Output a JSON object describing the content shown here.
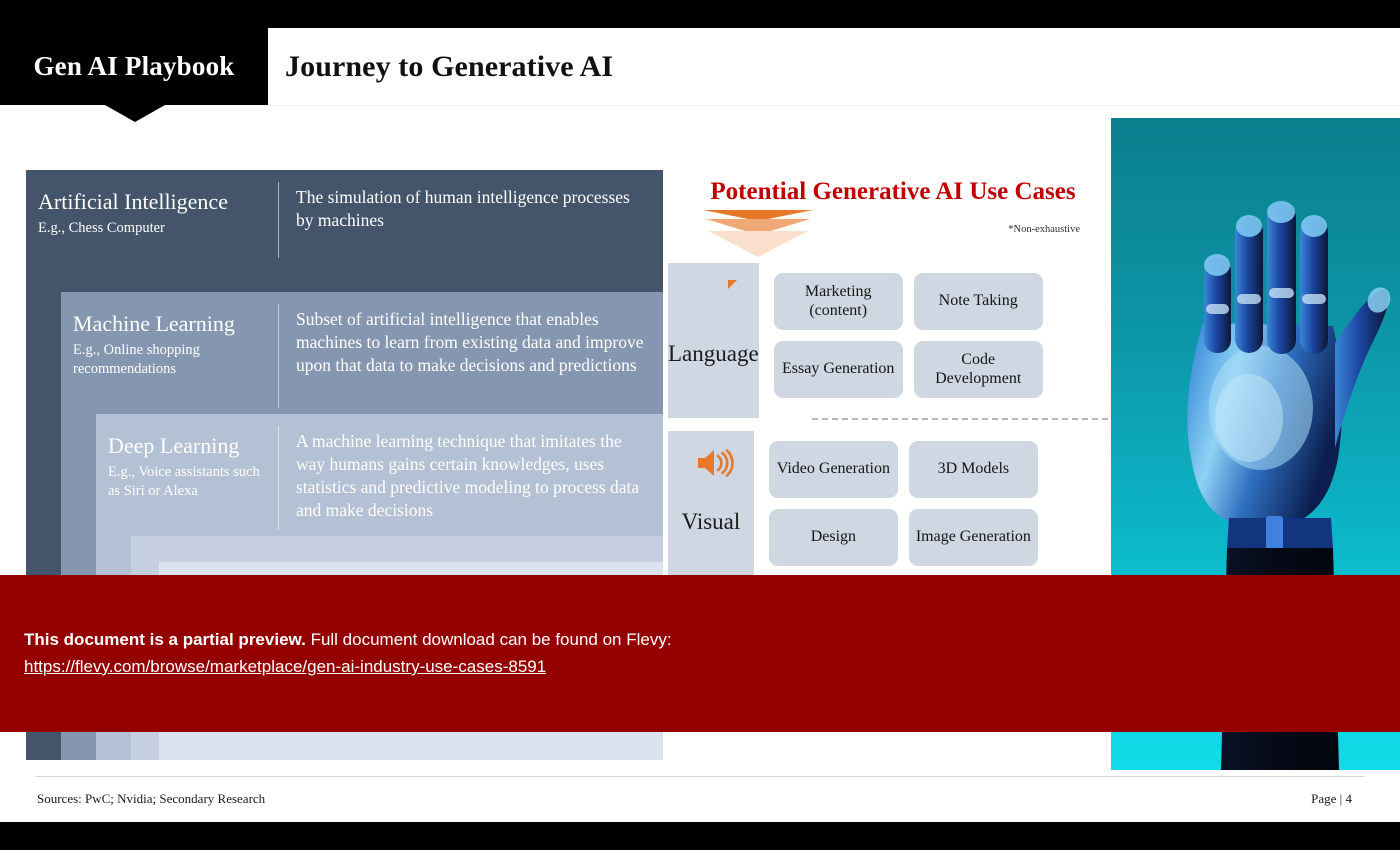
{
  "header": {
    "brand_tab": "Gen AI Playbook",
    "title": "Journey to Generative AI"
  },
  "ai_diagram": {
    "layers": [
      {
        "title": "Artificial Intelligence",
        "example": "E.g., Chess Computer",
        "description": "The simulation of human intelligence processes by machines",
        "color": "#44546a"
      },
      {
        "title": "Machine Learning",
        "example": "E.g., Online shopping recommendations",
        "description": "Subset of artificial intelligence that enables machines to learn from existing data and improve upon that data to make decisions and predictions",
        "color": "#8496b0"
      },
      {
        "title": "Deep Learning",
        "example": "E.g., Voice assistants such as Siri or Alexa",
        "description": "A machine learning technique that imitates the way humans gains certain knowledges, uses statistics and predictive modeling to process data and make decisions",
        "color": "#b4c0d3"
      }
    ]
  },
  "use_cases": {
    "title": "Potential Generative AI Use Cases",
    "footnote": "*Non-exhaustive",
    "title_color": "#c00000",
    "accent_color": "#e8792b",
    "categories": [
      {
        "label": "Language",
        "icon": "speech-bubble-icon",
        "cards": [
          "Marketing (content)",
          "Note Taking",
          "Essay Generation",
          "Code Development"
        ]
      },
      {
        "label": "Visual",
        "icon": "speaker-icon",
        "cards": [
          "Video Generation",
          "3D Models",
          "Design",
          "Image Generation"
        ]
      }
    ]
  },
  "hero": {
    "alt": "robotic-hand-image",
    "background_color": "#0cb3c6"
  },
  "preview_banner": {
    "bold_text": "This document is a partial preview.",
    "rest_text": " Full document download can be found on Flevy:",
    "url": "https://flevy.com/browse/marketplace/gen-ai-industry-use-cases-8591 ",
    "background_color": "#940000"
  },
  "footer": {
    "sources": "Sources: PwC; Nvidia; Secondary Research",
    "page": "Page | 4"
  }
}
